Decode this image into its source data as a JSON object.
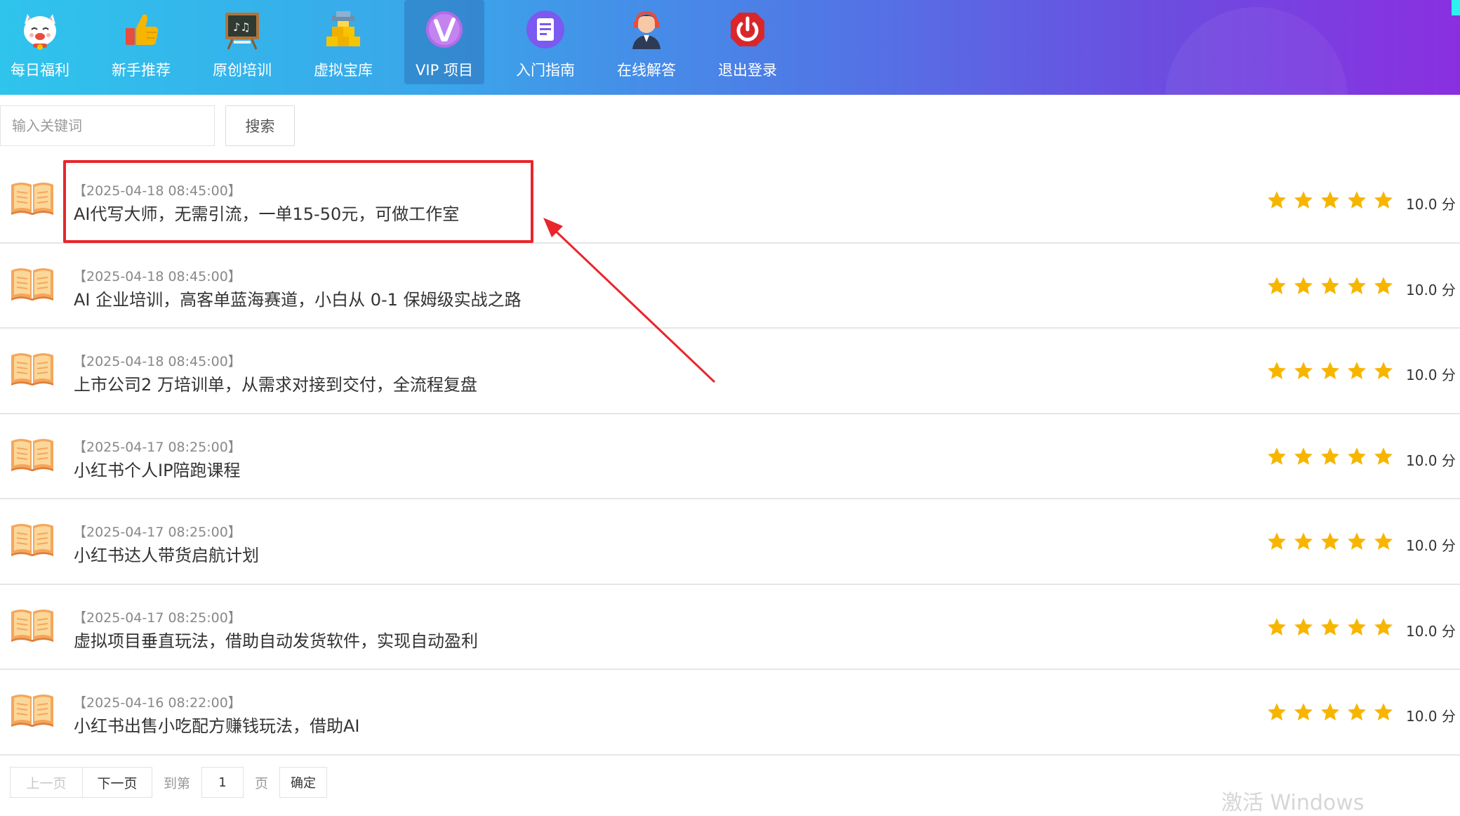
{
  "nav": {
    "items": [
      {
        "label": "每日福利",
        "icon": "lucky-cat-icon"
      },
      {
        "label": "新手推荐",
        "icon": "thumbs-up-icon"
      },
      {
        "label": "原创培训",
        "icon": "chalkboard-icon"
      },
      {
        "label": "虚拟宝库",
        "icon": "gold-bars-icon"
      },
      {
        "label": "VIP 项目",
        "icon": "vip-badge-icon",
        "active": true
      },
      {
        "label": "入门指南",
        "icon": "document-icon"
      },
      {
        "label": "在线解答",
        "icon": "support-agent-icon"
      },
      {
        "label": "退出登录",
        "icon": "power-icon"
      }
    ]
  },
  "search": {
    "placeholder": "输入关键词",
    "value": "",
    "button_label": "搜索"
  },
  "list": {
    "items": [
      {
        "date": "【2025-04-18 08:45:00】",
        "title": "AI代写大师，无需引流，一单15-50元，可做工作室",
        "score": "10.0 分",
        "rating": 5
      },
      {
        "date": "【2025-04-18 08:45:00】",
        "title": "AI 企业培训，高客单蓝海赛道，小白从 0-1 保姆级实战之路",
        "score": "10.0 分",
        "rating": 5
      },
      {
        "date": "【2025-04-18 08:45:00】",
        "title": "上市公司2 万培训单，从需求对接到交付，全流程复盘",
        "score": "10.0 分",
        "rating": 5
      },
      {
        "date": "【2025-04-17 08:25:00】",
        "title": "小红书个人IP陪跑课程",
        "score": "10.0 分",
        "rating": 5
      },
      {
        "date": "【2025-04-17 08:25:00】",
        "title": "小红书达人带货启航计划",
        "score": "10.0 分",
        "rating": 5
      },
      {
        "date": "【2025-04-17 08:25:00】",
        "title": "虚拟项目垂直玩法，借助自动发货软件，实现自动盈利",
        "score": "10.0 分",
        "rating": 5
      },
      {
        "date": "【2025-04-16 08:22:00】",
        "title": "小红书出售小吃配方赚钱玩法，借助AI",
        "score": "10.0 分",
        "rating": 5
      }
    ]
  },
  "pagination": {
    "prev_label": "上一页",
    "next_label": "下一页",
    "goto_prefix": "到第",
    "page_value": "1",
    "goto_suffix": "页",
    "confirm_label": "确定"
  },
  "watermark": "激活 Windows",
  "colors": {
    "highlight": "#e8262b",
    "star": "#f7b500",
    "gradient_start": "#2fc4ec",
    "gradient_end": "#8a2fe0"
  }
}
